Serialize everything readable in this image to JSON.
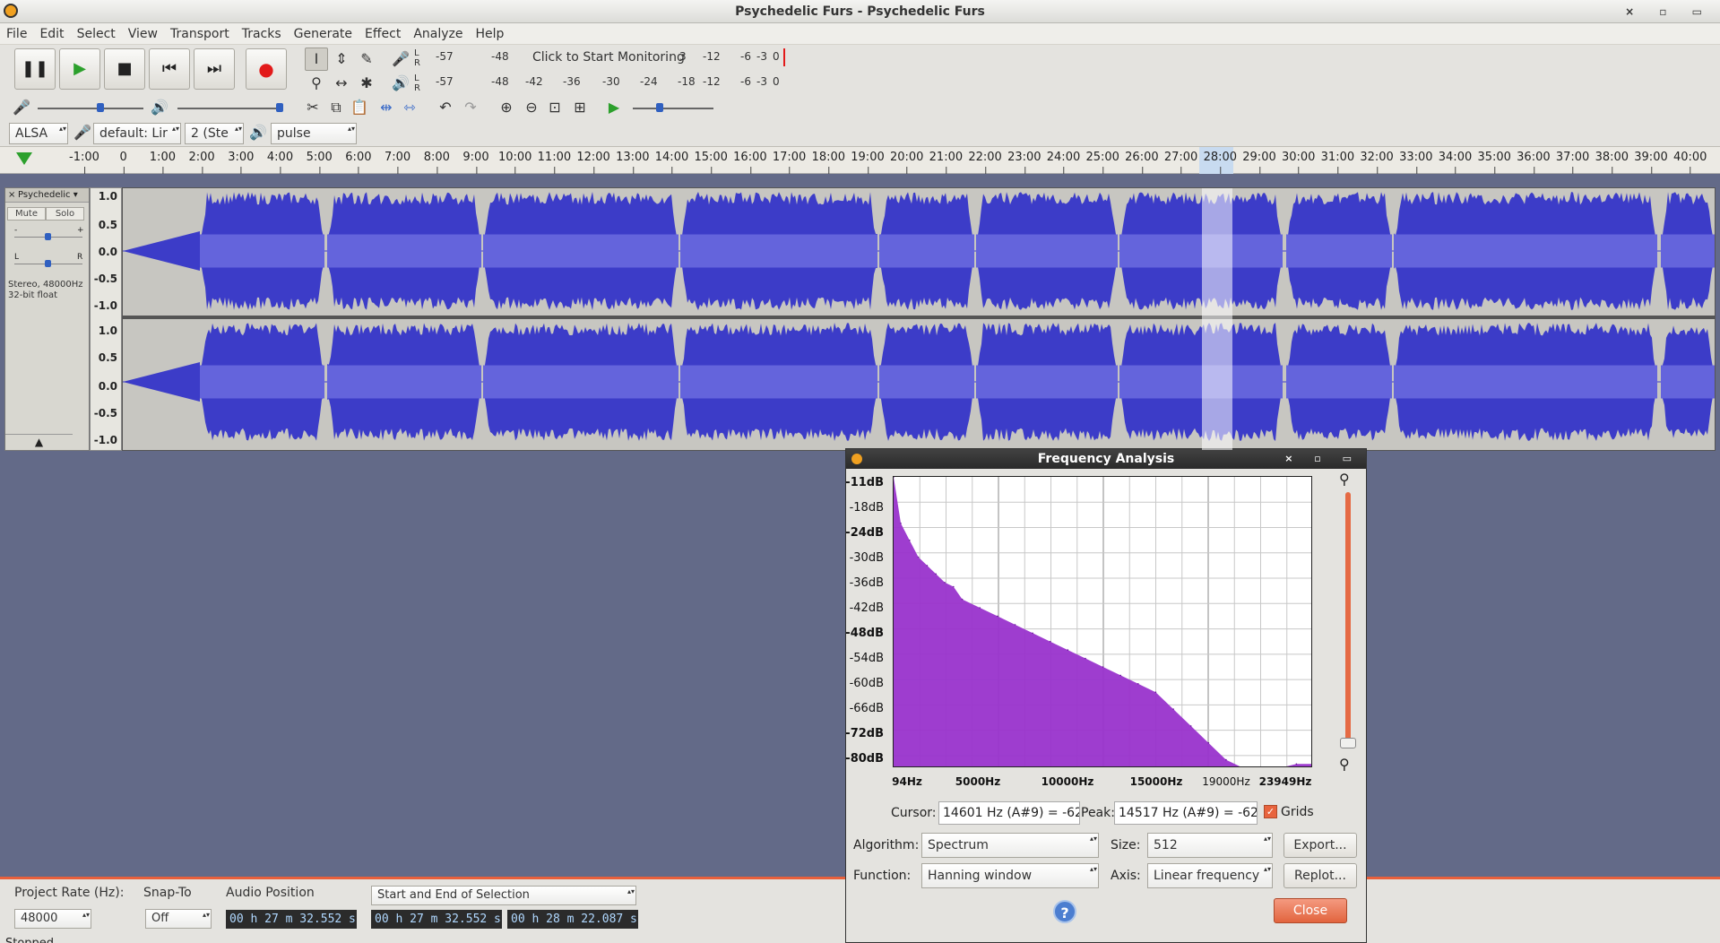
{
  "window": {
    "title": "Psychedelic Furs - Psychedelic Furs",
    "controls": "× ▫ ▭"
  },
  "menu": [
    "File",
    "Edit",
    "Select",
    "View",
    "Transport",
    "Tracks",
    "Generate",
    "Effect",
    "Analyze",
    "Help"
  ],
  "transport": {
    "pause": "❚❚",
    "play": "▶",
    "stop": "■",
    "skip_start": "⏮",
    "skip_end": "⏭",
    "record": "●"
  },
  "tools": {
    "select": "I",
    "envelope": "⇕",
    "draw": "✎",
    "zoom": "⚲",
    "timeshift": "↔",
    "multi": "✱"
  },
  "meters": {
    "rec_scale": [
      "-57",
      "-48",
      "Click to Start Monitoring",
      "3",
      "-12",
      "-6",
      "-3",
      "0"
    ],
    "play_scale": [
      "-57",
      "-48",
      "-42",
      "-36",
      "-30",
      "-24",
      "-18",
      "-12",
      "-6",
      "-3",
      "0"
    ],
    "lr": [
      "L",
      "R"
    ]
  },
  "edit": {
    "cut": "✂",
    "copy": "⧉",
    "paste": "📋",
    "trim": "⇹",
    "silence": "⇿",
    "undo": "↶",
    "redo": "↷",
    "zoom_in": "⊕",
    "zoom_out": "⊖",
    "fit_sel": "⊡",
    "fit_proj": "⊞",
    "play_at_speed": "▶"
  },
  "device": {
    "host": "ALSA",
    "rec_device": "default: Lir",
    "channels": "2 (Ste",
    "play_device": "pulse"
  },
  "ruler": [
    "-1:00",
    "0",
    "1:00",
    "2:00",
    "3:00",
    "4:00",
    "5:00",
    "6:00",
    "7:00",
    "8:00",
    "9:00",
    "10:00",
    "11:00",
    "12:00",
    "13:00",
    "14:00",
    "15:00",
    "16:00",
    "17:00",
    "18:00",
    "19:00",
    "20:00",
    "21:00",
    "22:00",
    "23:00",
    "24:00",
    "25:00",
    "26:00",
    "27:00",
    "28:00",
    "29:00",
    "30:00",
    "31:00",
    "32:00",
    "33:00",
    "34:00",
    "35:00",
    "36:00",
    "37:00",
    "38:00",
    "39:00",
    "40:00"
  ],
  "track": {
    "name": "Psychedelic",
    "close": "×",
    "mute": "Mute",
    "solo": "Solo",
    "gain_minus": "-",
    "gain_plus": "+",
    "pan_l": "L",
    "pan_r": "R",
    "info_line1": "Stereo, 48000Hz",
    "info_line2": "32-bit float",
    "collapse": "▲",
    "scale": [
      "1.0",
      "0.5",
      "0.0",
      "-0.5",
      "-1.0"
    ]
  },
  "status": {
    "project_rate_label": "Project Rate (Hz):",
    "project_rate": "48000",
    "snap_to_label": "Snap-To",
    "snap_to": "Off",
    "audio_position_label": "Audio Position",
    "selection_mode": "Start and End of Selection",
    "audio_position": "00 h 27 m 32.552 s",
    "sel_start": "00 h 27 m 32.552 s",
    "sel_end": "00 h 28 m 22.087 s",
    "state": "Stopped."
  },
  "freq_dialog": {
    "title": "Frequency Analysis",
    "y_labels": [
      "-11dB",
      "-18dB",
      "-24dB",
      "-30dB",
      "-36dB",
      "-42dB",
      "-48dB",
      "-54dB",
      "-60dB",
      "-66dB",
      "-72dB",
      "-80dB"
    ],
    "x_labels": [
      "94Hz",
      "5000Hz",
      "10000Hz",
      "15000Hz",
      "19000Hz",
      "23949Hz"
    ],
    "cursor_label": "Cursor:",
    "cursor_value": "14601 Hz (A#9) = -62",
    "peak_label": "Peak:",
    "peak_value": "14517 Hz (A#9) = -62",
    "grids_label": "Grids",
    "grids_checked": true,
    "algorithm_label": "Algorithm:",
    "algorithm": "Spectrum",
    "size_label": "Size:",
    "size": "512",
    "export": "Export...",
    "function_label": "Function:",
    "function": "Hanning window",
    "axis_label": "Axis:",
    "axis": "Linear frequency",
    "replot": "Replot...",
    "help": "?",
    "close": "Close",
    "zoom_in_icon": "zoom-in-icon",
    "zoom_out_icon": "zoom-out-icon"
  },
  "chart_data": {
    "type": "area",
    "xlabel": "",
    "ylabel": "",
    "xlim": [
      94,
      23949
    ],
    "ylim": [
      -80,
      -11
    ],
    "grid": true,
    "x": [
      94,
      500,
      1000,
      1500,
      2000,
      2500,
      3000,
      3500,
      4000,
      5000,
      6000,
      7000,
      8000,
      9000,
      10000,
      11000,
      12000,
      13000,
      14000,
      15000,
      16000,
      17000,
      18000,
      19000,
      20000,
      21000,
      22000,
      23000,
      23949
    ],
    "y": [
      -11,
      -22,
      -26,
      -30,
      -32,
      -34,
      -36,
      -37,
      -40,
      -42,
      -44,
      -46,
      -48,
      -50,
      -52,
      -54,
      -56,
      -58,
      -60,
      -62,
      -66,
      -70,
      -74,
      -78,
      -80,
      -80,
      -80,
      -79,
      -79
    ]
  },
  "colors": {
    "waveform": "#3c3cc8",
    "waveform_rms": "#6464dc",
    "spectrum": "#9933cc",
    "accent": "#e8643e"
  }
}
